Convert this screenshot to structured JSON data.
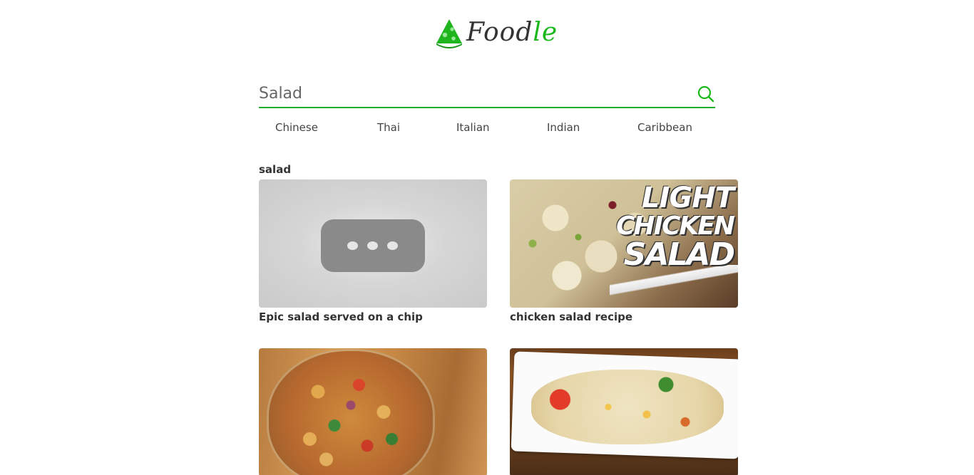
{
  "brand": {
    "name_main": "Food",
    "name_accent": "le",
    "accent_color": "#1bb81b"
  },
  "search": {
    "value": "Salad",
    "placeholder": "",
    "icon": "search-icon"
  },
  "cuisines": [
    "Chinese",
    "Thai",
    "Italian",
    "Indian",
    "Caribbean"
  ],
  "results": {
    "heading": "salad",
    "cards": [
      {
        "title": "Epic salad served on a chip",
        "thumbnail": "loading"
      },
      {
        "title": "chicken salad recipe",
        "thumbnail": "chicken",
        "overlay": [
          "LIGHT",
          "CHICKEN",
          "SALAD"
        ]
      },
      {
        "title": "",
        "thumbnail": "chickpea"
      },
      {
        "title": "",
        "thumbnail": "pasta"
      }
    ]
  }
}
